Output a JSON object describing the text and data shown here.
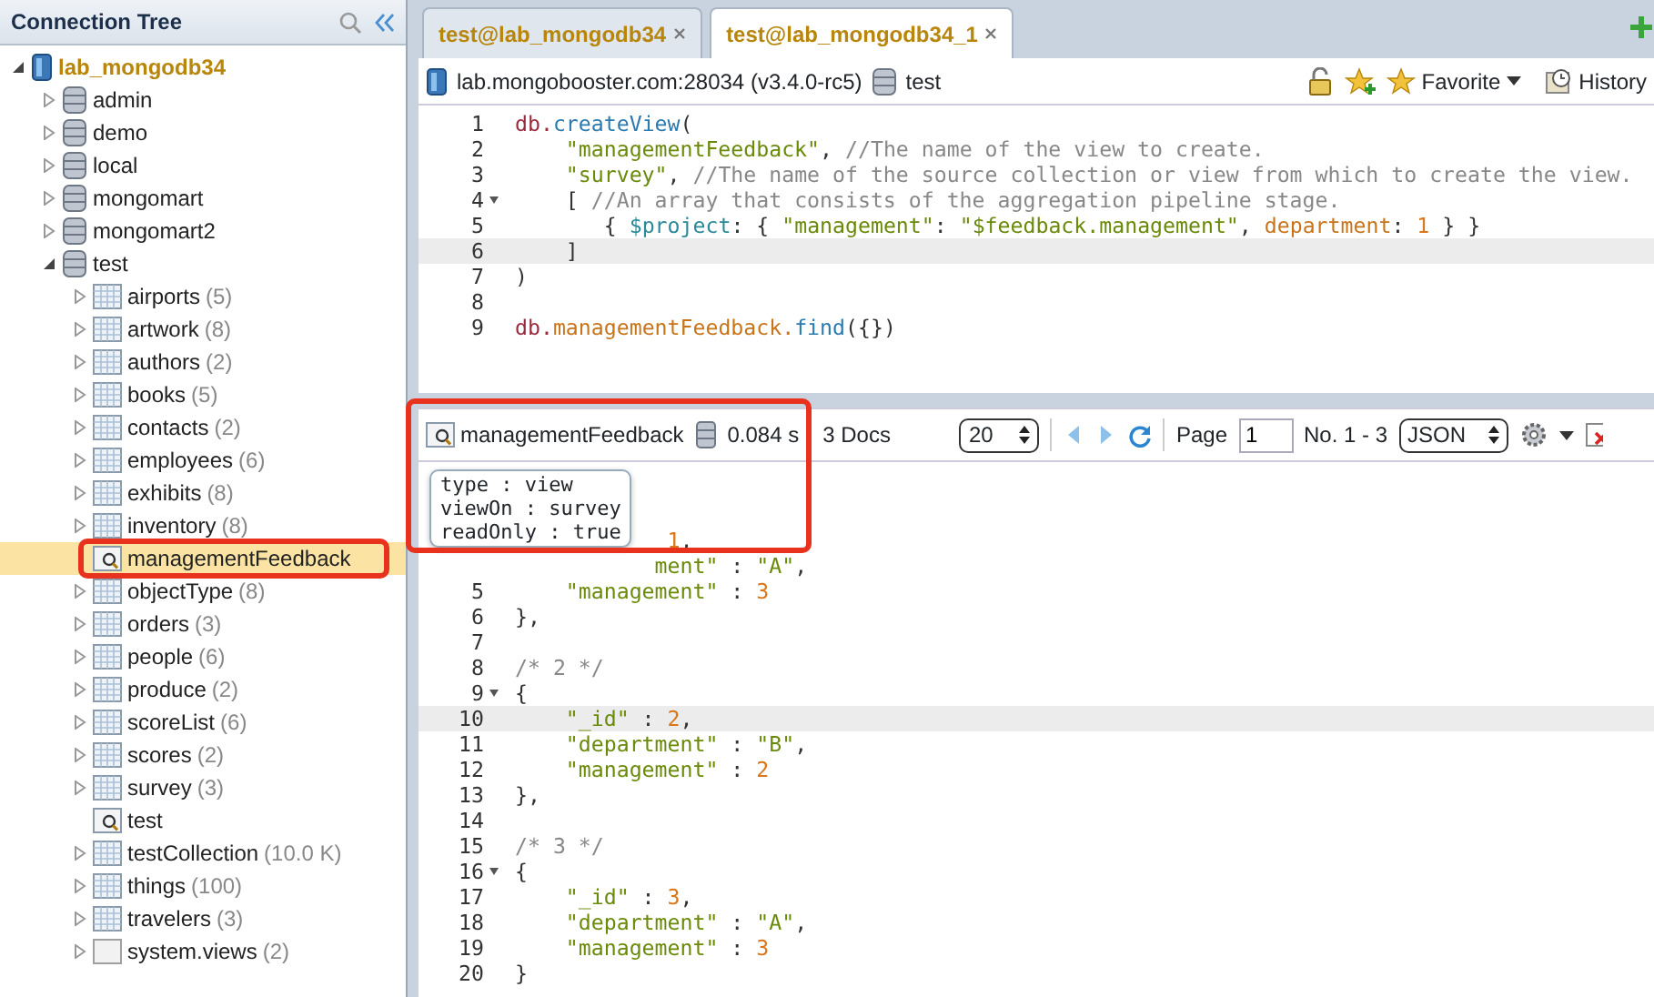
{
  "sidebar": {
    "title": "Connection Tree",
    "tree": [
      {
        "label": "lab_mongodb34",
        "kind": "server",
        "expanded": true,
        "selected": false,
        "children": [
          {
            "label": "admin",
            "kind": "db",
            "expanded": false,
            "selected": false
          },
          {
            "label": "demo",
            "kind": "db",
            "expanded": false,
            "selected": false
          },
          {
            "label": "local",
            "kind": "db",
            "expanded": false,
            "selected": false
          },
          {
            "label": "mongomart",
            "kind": "db",
            "expanded": false,
            "selected": false
          },
          {
            "label": "mongomart2",
            "kind": "db",
            "expanded": false,
            "selected": false
          },
          {
            "label": "test",
            "kind": "db",
            "expanded": true,
            "selected": false,
            "children": [
              {
                "label": "airports",
                "count": "(5)",
                "kind": "collection",
                "expanded": false,
                "selected": false
              },
              {
                "label": "artwork",
                "count": "(8)",
                "kind": "collection",
                "expanded": false,
                "selected": false
              },
              {
                "label": "authors",
                "count": "(2)",
                "kind": "collection",
                "expanded": false,
                "selected": false
              },
              {
                "label": "books",
                "count": "(5)",
                "kind": "collection",
                "expanded": false,
                "selected": false
              },
              {
                "label": "contacts",
                "count": "(2)",
                "kind": "collection",
                "expanded": false,
                "selected": false
              },
              {
                "label": "employees",
                "count": "(6)",
                "kind": "collection",
                "expanded": false,
                "selected": false
              },
              {
                "label": "exhibits",
                "count": "(8)",
                "kind": "collection",
                "expanded": false,
                "selected": false
              },
              {
                "label": "inventory",
                "count": "(8)",
                "kind": "collection",
                "expanded": false,
                "selected": false
              },
              {
                "label": "managementFeedback",
                "kind": "view",
                "selected": true,
                "annotated": true
              },
              {
                "label": "objectType",
                "count": "(8)",
                "kind": "collection",
                "expanded": false,
                "selected": false
              },
              {
                "label": "orders",
                "count": "(3)",
                "kind": "collection",
                "expanded": false,
                "selected": false
              },
              {
                "label": "people",
                "count": "(6)",
                "kind": "collection",
                "expanded": false,
                "selected": false
              },
              {
                "label": "produce",
                "count": "(2)",
                "kind": "collection",
                "expanded": false,
                "selected": false
              },
              {
                "label": "scoreList",
                "count": "(6)",
                "kind": "collection",
                "expanded": false,
                "selected": false
              },
              {
                "label": "scores",
                "count": "(2)",
                "kind": "collection",
                "expanded": false,
                "selected": false
              },
              {
                "label": "survey",
                "count": "(3)",
                "kind": "collection",
                "expanded": false,
                "selected": false
              },
              {
                "label": "test",
                "kind": "view",
                "selected": false
              },
              {
                "label": "testCollection",
                "count": "(10.0 K)",
                "kind": "collection",
                "expanded": false,
                "selected": false
              },
              {
                "label": "things",
                "count": "(100)",
                "kind": "collection",
                "expanded": false,
                "selected": false
              },
              {
                "label": "travelers",
                "count": "(3)",
                "kind": "collection",
                "expanded": false,
                "selected": false
              },
              {
                "label": "system.views",
                "count": "(2)",
                "kind": "system",
                "expanded": false,
                "selected": false
              }
            ]
          }
        ]
      }
    ]
  },
  "tabs": [
    {
      "label": "test@lab_mongodb34",
      "selected": false
    },
    {
      "label": "test@lab_mongodb34_1",
      "selected": true
    }
  ],
  "connection_bar": {
    "server": "lab.mongobooster.com:28034 (v3.4.0-rc5)",
    "database": "test",
    "favorite": "Favorite",
    "history": "History"
  },
  "editor": {
    "lines": [
      {
        "n": "1",
        "tokens": [
          {
            "text": "db.",
            "kind": "db"
          },
          {
            "text": "createView",
            "kind": "fn"
          },
          {
            "text": "(",
            "kind": "punc"
          }
        ]
      },
      {
        "n": "2",
        "tokens": [
          {
            "text": "    \"managementFeedback\"",
            "kind": "str"
          },
          {
            "text": ", ",
            "kind": "punc"
          },
          {
            "text": "//The name of the view to create.",
            "kind": "cmt"
          }
        ]
      },
      {
        "n": "3",
        "tokens": [
          {
            "text": "    \"survey\"",
            "kind": "str"
          },
          {
            "text": ", ",
            "kind": "punc"
          },
          {
            "text": "//The name of the source collection or view from which to create the view.",
            "kind": "cmt"
          }
        ]
      },
      {
        "n": "4",
        "fold": true,
        "tokens": [
          {
            "text": "    [",
            "kind": "punc"
          },
          {
            "text": " //An array that consists of the aggregation pipeline stage.",
            "kind": "cmt"
          }
        ]
      },
      {
        "n": "5",
        "tokens": [
          {
            "text": "       { ",
            "kind": "punc"
          },
          {
            "text": "$project",
            "kind": "key"
          },
          {
            "text": ": { ",
            "kind": "punc"
          },
          {
            "text": "\"management\"",
            "kind": "str"
          },
          {
            "text": ": ",
            "kind": "punc"
          },
          {
            "text": "\"$feedback.management\"",
            "kind": "str"
          },
          {
            "text": ", ",
            "kind": "punc"
          },
          {
            "text": "department",
            "kind": "prop"
          },
          {
            "text": ": ",
            "kind": "punc"
          },
          {
            "text": "1",
            "kind": "num"
          },
          {
            "text": " } }",
            "kind": "punc"
          }
        ]
      },
      {
        "n": "6",
        "active": true,
        "tokens": [
          {
            "text": "    ]",
            "kind": "punc"
          }
        ]
      },
      {
        "n": "7",
        "tokens": [
          {
            "text": ")",
            "kind": "punc"
          }
        ]
      },
      {
        "n": "8"
      },
      {
        "n": "9",
        "tokens": [
          {
            "text": "db.",
            "kind": "db"
          },
          {
            "text": "managementFeedback.",
            "kind": "prop"
          },
          {
            "text": "find",
            "kind": "fn"
          },
          {
            "text": "({})",
            "kind": "punc"
          }
        ]
      }
    ]
  },
  "result_bar": {
    "name": "managementFeedback",
    "annotated": true,
    "time": "0.084 s",
    "docs": "3 Docs",
    "page_size": "20",
    "page_label": "Page",
    "page": "1",
    "range": "No. 1 - 3",
    "format": "JSON",
    "tooltip": [
      "type : view",
      "viewOn : survey",
      "readOnly : true"
    ]
  },
  "results": {
    "lines": [
      {
        "tokens": [
          {
            "text": "            1",
            "kind": "num"
          },
          {
            "text": ",",
            "kind": "punc"
          }
        ]
      },
      {
        "tokens": [
          {
            "text": "           ment\"",
            "kind": "str"
          },
          {
            "text": " : ",
            "kind": "punc"
          },
          {
            "text": "\"A\"",
            "kind": "str"
          },
          {
            "text": ",",
            "kind": "punc"
          }
        ]
      },
      {
        "n": "5",
        "tokens": [
          {
            "text": "    \"management\"",
            "kind": "str"
          },
          {
            "text": " : ",
            "kind": "punc"
          },
          {
            "text": "3",
            "kind": "num"
          }
        ]
      },
      {
        "n": "6",
        "tokens": [
          {
            "text": "},",
            "kind": "punc"
          }
        ]
      },
      {
        "n": "7"
      },
      {
        "n": "8",
        "tokens": [
          {
            "text": "/* 2 */",
            "kind": "cmt"
          }
        ]
      },
      {
        "n": "9",
        "fold": true,
        "tokens": [
          {
            "text": "{",
            "kind": "punc"
          }
        ]
      },
      {
        "n": "10",
        "active": true,
        "tokens": [
          {
            "text": "    \"_id\"",
            "kind": "str"
          },
          {
            "text": " : ",
            "kind": "punc"
          },
          {
            "text": "2",
            "kind": "num"
          },
          {
            "text": ",",
            "kind": "punc"
          }
        ]
      },
      {
        "n": "11",
        "tokens": [
          {
            "text": "    \"department\"",
            "kind": "str"
          },
          {
            "text": " : ",
            "kind": "punc"
          },
          {
            "text": "\"B\"",
            "kind": "str"
          },
          {
            "text": ",",
            "kind": "punc"
          }
        ]
      },
      {
        "n": "12",
        "tokens": [
          {
            "text": "    \"management\"",
            "kind": "str"
          },
          {
            "text": " : ",
            "kind": "punc"
          },
          {
            "text": "2",
            "kind": "num"
          }
        ]
      },
      {
        "n": "13",
        "tokens": [
          {
            "text": "},",
            "kind": "punc"
          }
        ]
      },
      {
        "n": "14"
      },
      {
        "n": "15",
        "tokens": [
          {
            "text": "/* 3 */",
            "kind": "cmt"
          }
        ]
      },
      {
        "n": "16",
        "fold": true,
        "tokens": [
          {
            "text": "{",
            "kind": "punc"
          }
        ]
      },
      {
        "n": "17",
        "tokens": [
          {
            "text": "    \"_id\"",
            "kind": "str"
          },
          {
            "text": " : ",
            "kind": "punc"
          },
          {
            "text": "3",
            "kind": "num"
          },
          {
            "text": ",",
            "kind": "punc"
          }
        ]
      },
      {
        "n": "18",
        "tokens": [
          {
            "text": "    \"department\"",
            "kind": "str"
          },
          {
            "text": " : ",
            "kind": "punc"
          },
          {
            "text": "\"A\"",
            "kind": "str"
          },
          {
            "text": ",",
            "kind": "punc"
          }
        ]
      },
      {
        "n": "19",
        "tokens": [
          {
            "text": "    \"management\"",
            "kind": "str"
          },
          {
            "text": " : ",
            "kind": "punc"
          },
          {
            "text": "3",
            "kind": "num"
          }
        ]
      },
      {
        "n": "20",
        "tokens": [
          {
            "text": "}",
            "kind": "punc"
          }
        ]
      }
    ]
  }
}
